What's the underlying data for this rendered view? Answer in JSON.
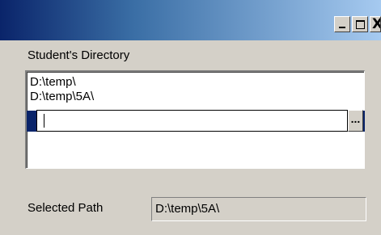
{
  "window": {
    "title_buttons": {
      "minimize_icon": "minimize-icon",
      "maximize_icon": "maximize-icon",
      "close_label": "X"
    }
  },
  "directory": {
    "label": "Student's Directory",
    "items": [
      "D:\\temp\\",
      "D:\\temp\\5A\\"
    ],
    "edit_value": "",
    "browse_label": "..."
  },
  "selected": {
    "label": "Selected Path",
    "value": "D:\\temp\\5A\\"
  },
  "colors": {
    "selection": "#0a246a",
    "face": "#d4d0c8"
  }
}
